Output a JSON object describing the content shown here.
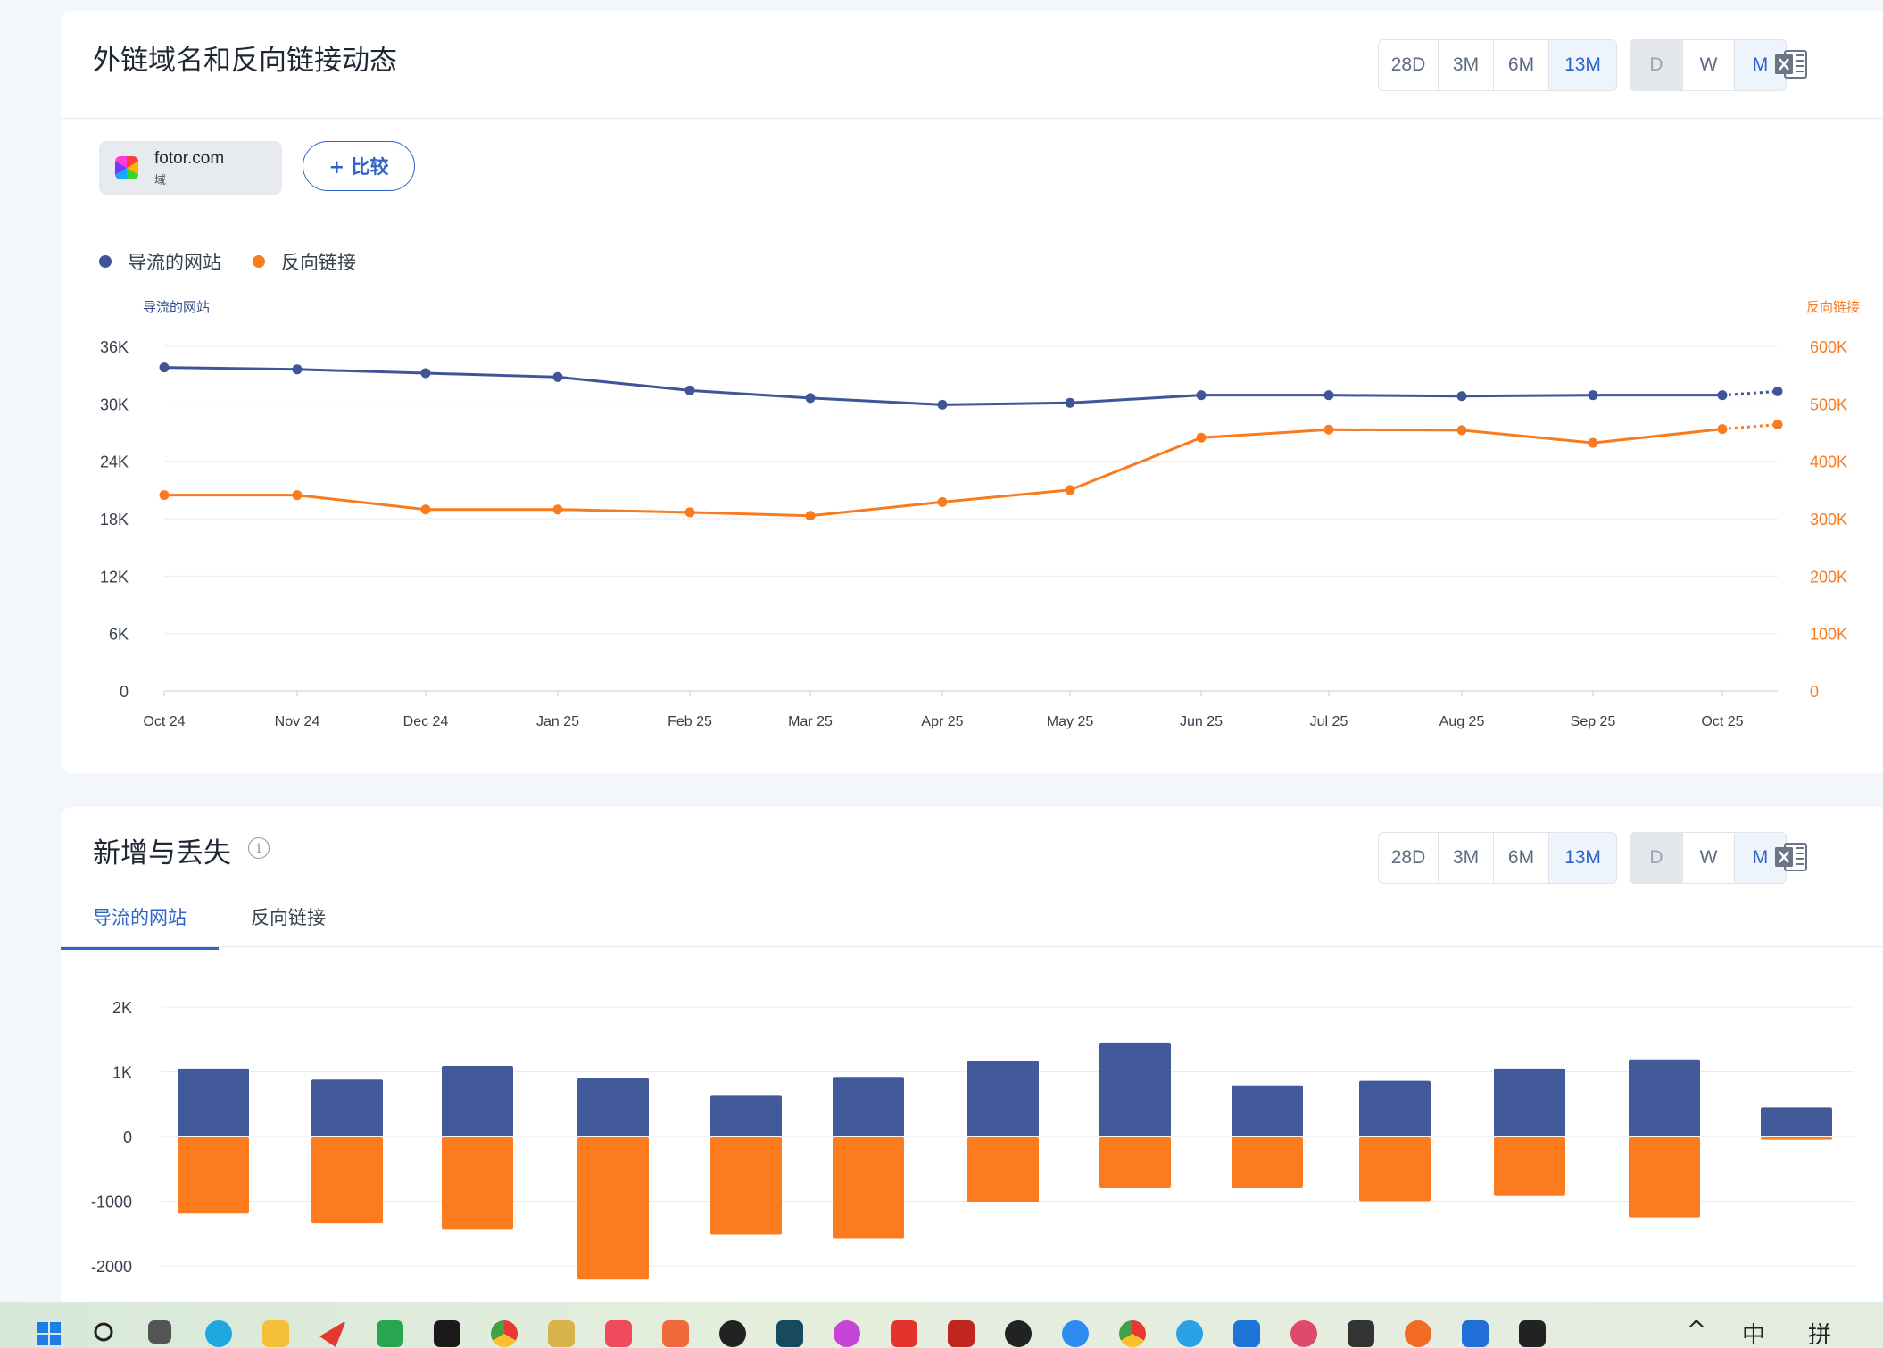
{
  "card1": {
    "title": "外链域名和反向链接动态",
    "range_buttons": [
      "28D",
      "3M",
      "6M",
      "13M"
    ],
    "range_active": "13M",
    "period_buttons": [
      "D",
      "W",
      "M"
    ],
    "period_active": "M",
    "period_disabled": "D",
    "excel_icon": "excel-icon",
    "domain_chip": {
      "domain": "fotor.com",
      "type": "域"
    },
    "compare_label": "+ 比较",
    "legend": [
      {
        "label": "导流的网站",
        "color": "#3f5596"
      },
      {
        "label": "反向链接",
        "color": "#fa7a1e"
      }
    ]
  },
  "card2": {
    "title": "新增与丢失",
    "info_icon": "info-icon",
    "range_buttons": [
      "28D",
      "3M",
      "6M",
      "13M"
    ],
    "range_active": "13M",
    "period_buttons": [
      "D",
      "W",
      "M"
    ],
    "period_active": "M",
    "period_disabled": "D",
    "tabs": [
      "导流的网站",
      "反向链接"
    ],
    "tab_active": "导流的网站"
  },
  "chart_data": [
    {
      "type": "line",
      "x": [
        "Oct 24",
        "Nov 24",
        "Dec 24",
        "Jan 25",
        "Feb 25",
        "Mar 25",
        "Apr 25",
        "May 25",
        "Jun 25",
        "Jul 25",
        "Aug 25",
        "Sep 25",
        "Oct 25",
        ""
      ],
      "left_axis": {
        "label": "导流的网站",
        "ticks": [
          "0",
          "6K",
          "12K",
          "18K",
          "24K",
          "30K",
          "36K"
        ],
        "range": [
          0,
          36000
        ]
      },
      "right_axis": {
        "label": "反向链接",
        "ticks": [
          "0",
          "100K",
          "200K",
          "300K",
          "400K",
          "500K",
          "600K"
        ],
        "range": [
          0,
          600000
        ]
      },
      "series": [
        {
          "name": "导流的网站",
          "axis": "left",
          "color": "#3f5596",
          "values": [
            33800,
            33600,
            33200,
            32800,
            31400,
            30600,
            29900,
            30100,
            30900,
            30900,
            30800,
            30900,
            30900,
            31300
          ],
          "last_point_projected": true
        },
        {
          "name": "反向链接",
          "axis": "right",
          "color": "#fa7a1e",
          "values": [
            341000,
            341000,
            316000,
            316000,
            311000,
            305000,
            329000,
            350000,
            441000,
            455000,
            454000,
            432000,
            456000,
            464000
          ],
          "last_point_projected": true
        }
      ],
      "grid": true,
      "legend_position": "top-left"
    },
    {
      "type": "bar",
      "stacked": true,
      "y_ticks": [
        "2K",
        "1K",
        "0",
        "-1000",
        "-2000"
      ],
      "ylim": [
        -2000,
        2000
      ],
      "series": [
        {
          "color": "#42599a",
          "values": [
            1050,
            880,
            1090,
            900,
            630,
            920,
            1170,
            1450,
            790,
            860,
            1050,
            1190,
            450
          ]
        },
        {
          "color": "#fc7b1f",
          "values": [
            -1190,
            -1340,
            -1440,
            -2210,
            -1510,
            -1580,
            -1020,
            -800,
            -800,
            -1000,
            -920,
            -1250,
            -50
          ]
        }
      ],
      "grid": true
    }
  ],
  "taskbar": {
    "icons": [
      "windows-start-icon",
      "search-icon",
      "task-view-icon",
      "edge-icon",
      "file-explorer-icon",
      "send-icon",
      "app-icon",
      "datagrip-icon",
      "chrome-icon",
      "app-icon",
      "app-icon",
      "app-icon",
      "panda-icon",
      "app-icon",
      "app-icon",
      "wps-icon",
      "app-icon",
      "app-icon",
      "app-icon",
      "chrome-icon",
      "app-icon",
      "app-icon",
      "app-icon",
      "terminal-icon",
      "app-icon",
      "app-icon",
      "app-icon"
    ],
    "tray_chevron": "^",
    "ime_lang": "中",
    "ime_mode": "拼"
  }
}
